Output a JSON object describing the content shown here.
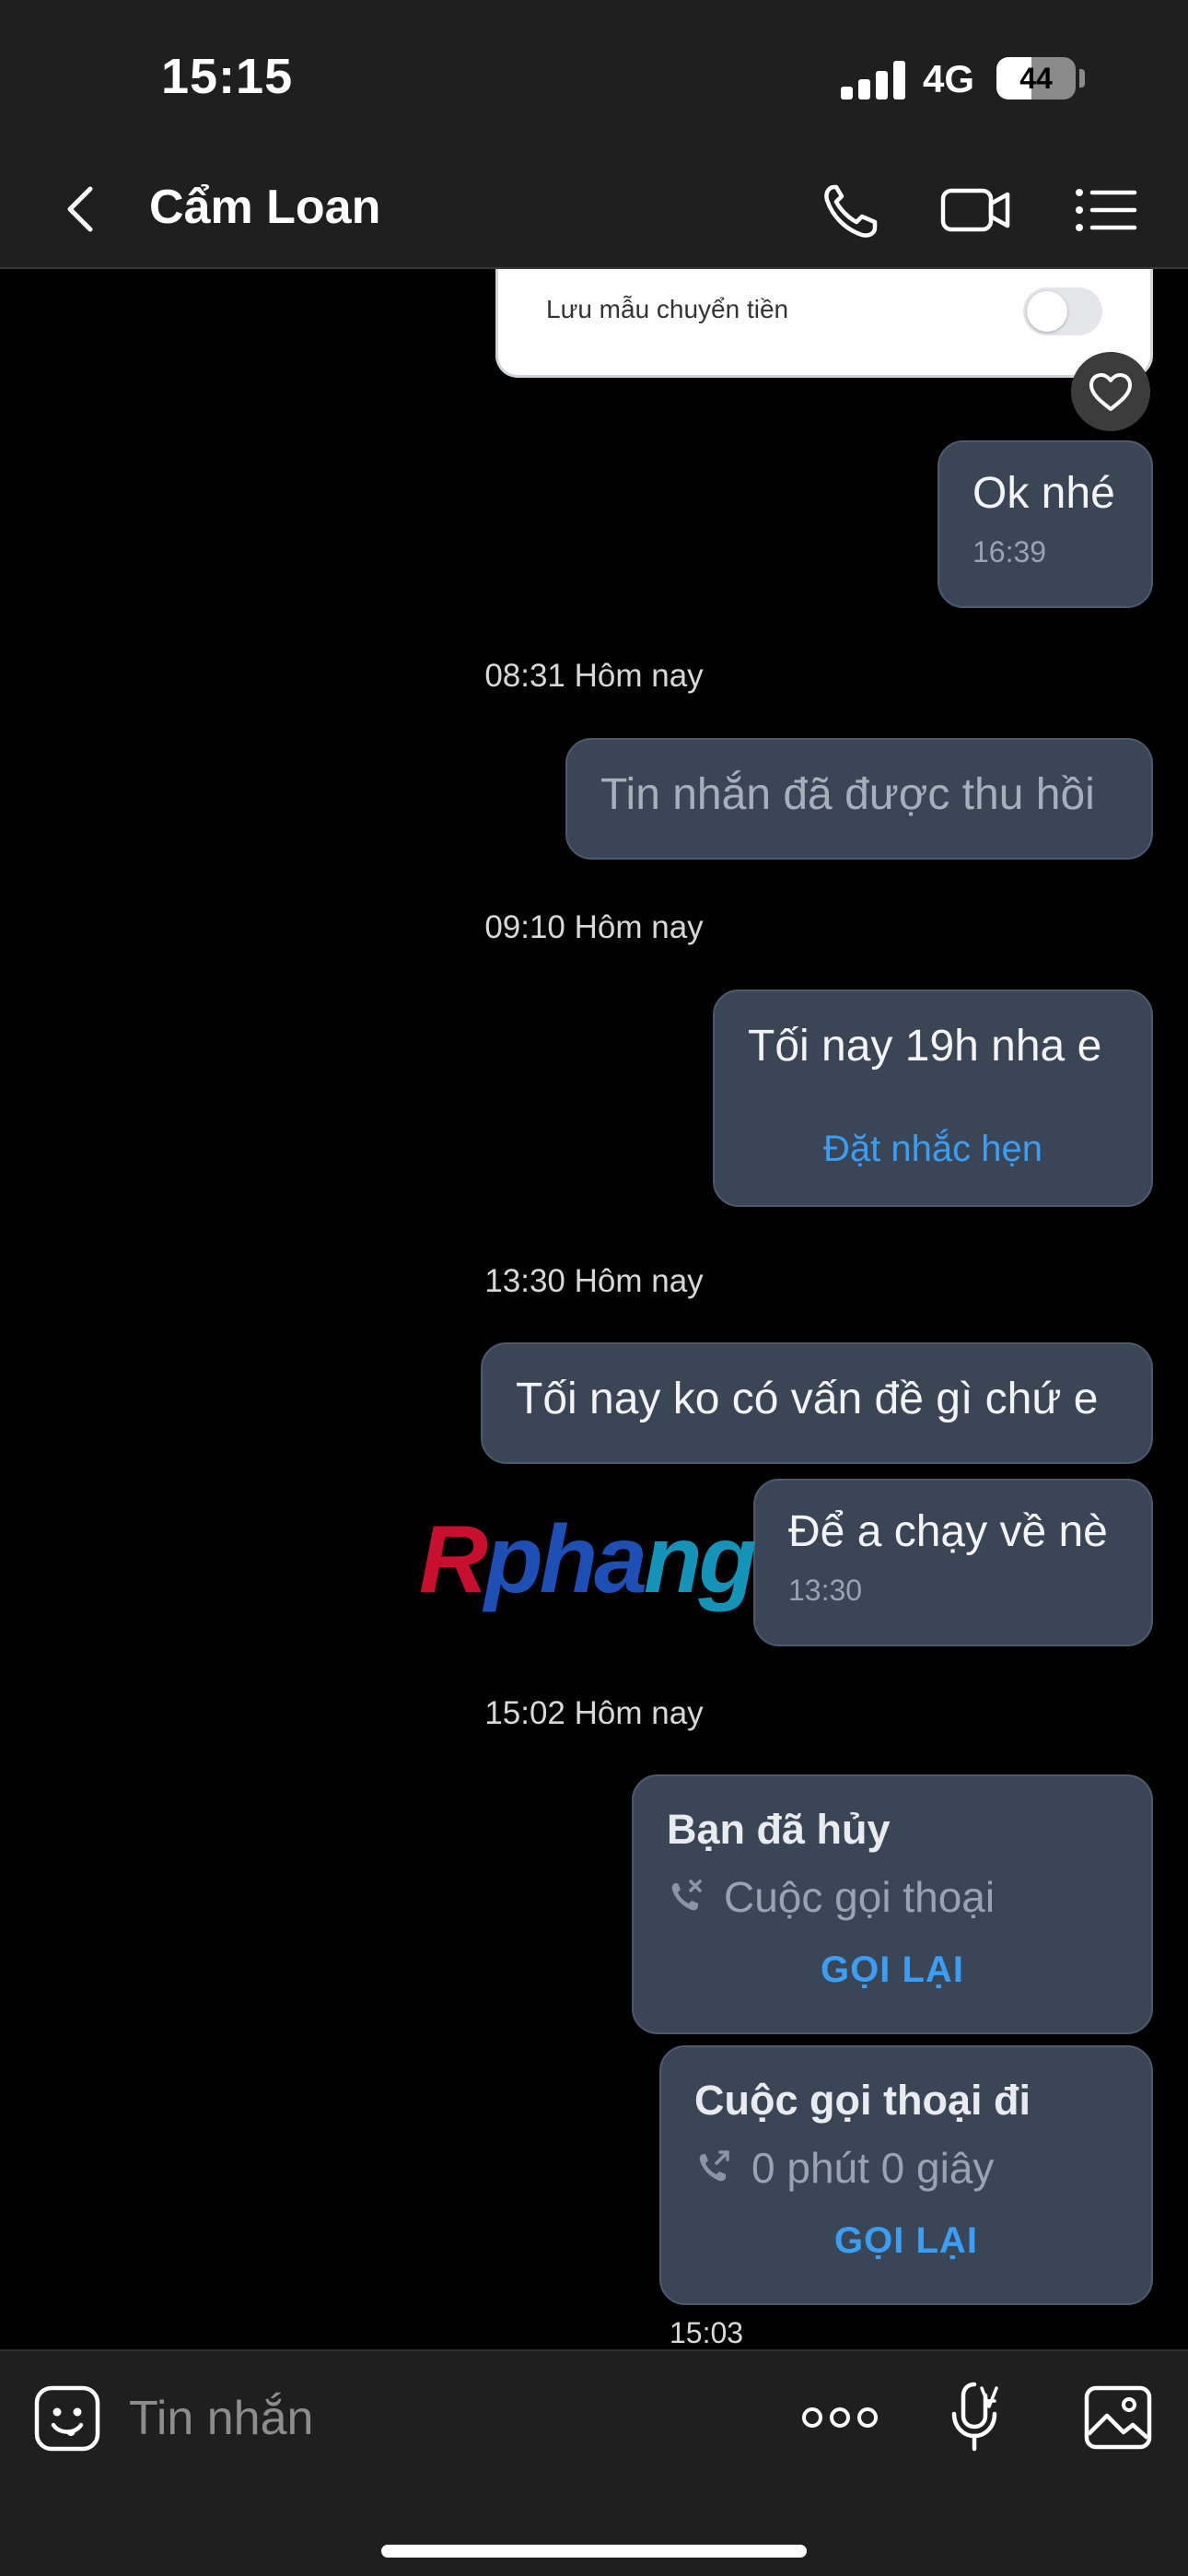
{
  "status_bar": {
    "time": "15:15",
    "network": "4G",
    "battery_percent": "44",
    "battery_level": 0.44
  },
  "header": {
    "contact_name": "Cẩm Loan",
    "icons": [
      "back-icon",
      "phone-icon",
      "video-call-icon",
      "menu-list-icon"
    ]
  },
  "chat": {
    "transfer_card": {
      "label": "Lưu mẫu chuyển tiền",
      "toggle_on": false
    },
    "messages": [
      {
        "text": "Ok nhé",
        "time": "16:39"
      },
      {
        "separator": "08:31 Hôm nay"
      },
      {
        "text": "Tin nhắn đã được thu hồi",
        "recalled": true
      },
      {
        "separator": "09:10 Hôm nay"
      },
      {
        "text": "Tối nay 19h nha e",
        "action": "Đặt nhắc hẹn"
      },
      {
        "separator": "13:30 Hôm nay"
      },
      {
        "text": "Tối nay ko có vấn đề gì chứ e"
      },
      {
        "text": "Để a chạy về nè",
        "time": "13:30"
      },
      {
        "separator": "15:02 Hôm nay"
      },
      {
        "call_title": "Bạn đã hủy",
        "call_sub": "Cuộc gọi thoại",
        "action": "GỌI LẠI"
      },
      {
        "call_title": "Cuộc gọi thoại đi",
        "call_sub": "0 phút 0 giây",
        "action": "GỌI LẠI",
        "time": "15:03"
      }
    ]
  },
  "watermark": {
    "part1": "R",
    "part2": "pha",
    "part3": "ng"
  },
  "input_bar": {
    "placeholder": "Tin nhắn",
    "icons": [
      "emoji-icon",
      "more-icon",
      "mic-icon",
      "image-icon"
    ]
  },
  "colors": {
    "background": "#000000",
    "bar": "#1f1f1f",
    "bubble": "#3a4556",
    "accent": "#3b9ef5"
  }
}
